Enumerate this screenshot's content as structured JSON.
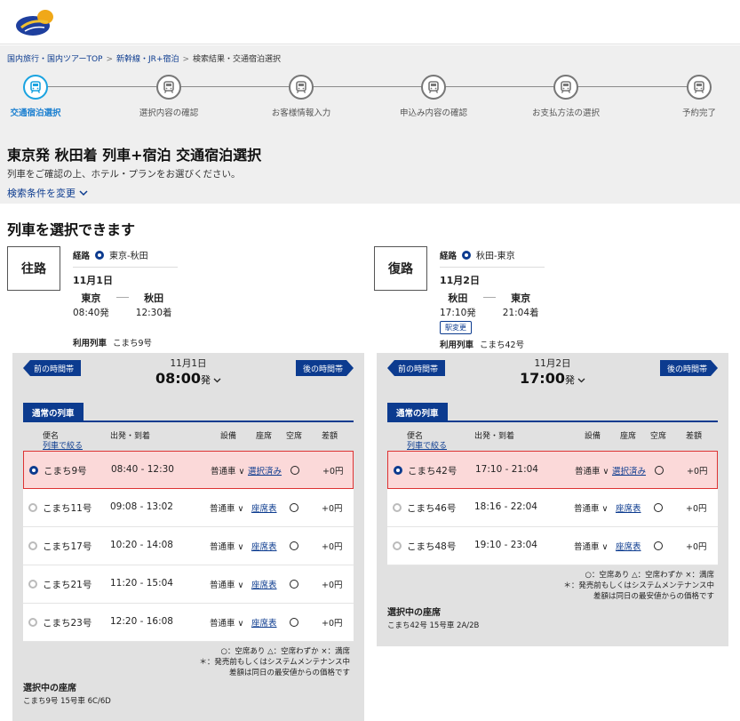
{
  "breadcrumb": [
    {
      "label": "国内旅行・国内ツアーTOP",
      "link": true
    },
    {
      "label": "新幹線・JR+宿泊",
      "link": true
    },
    {
      "label": "検索結果・交通宿泊選択",
      "link": false
    }
  ],
  "breadcrumb_sep": ">",
  "steps": [
    {
      "label": "交通宿泊選択",
      "active": true
    },
    {
      "label": "選択内容の確認",
      "active": false
    },
    {
      "label": "お客様情報入力",
      "active": false
    },
    {
      "label": "申込み内容の確認",
      "active": false
    },
    {
      "label": "お支払方法の選択",
      "active": false
    },
    {
      "label": "予約完了",
      "active": false
    }
  ],
  "page": {
    "title": "東京発 秋田着 列車+宿泊 交通宿泊選択",
    "subtitle": "列車をご確認の上、ホテル・プランをお選びください。",
    "change_condition": "検索条件を変更",
    "select_heading": "列車を選択できます"
  },
  "outbound": {
    "direction_label": "往路",
    "route_key": "経路",
    "route": "東京-秋田",
    "date": "11月1日",
    "from_station": "東京",
    "to_station": "秋田",
    "dep_time": "08:40発",
    "arr_time": "12:30着",
    "used_train_key": "利用列車",
    "used_train": "こまち9号",
    "panel": {
      "prev": "前の時間帯",
      "next": "後の時間帯",
      "date": "11月1日",
      "time": "08:00",
      "time_suffix": "発",
      "tab": "通常の列車",
      "cols": {
        "train": "便名",
        "filter": "列車で絞る",
        "time": "出発・到着",
        "equip": "設備",
        "seat": "座席",
        "avail": "空席",
        "diff": "差額"
      },
      "rows": [
        {
          "name": "こまち9号",
          "time": "08:40 - 12:30",
          "equip": "普通車",
          "seat": "選択済み",
          "price": "+0円",
          "selected": true
        },
        {
          "name": "こまち11号",
          "time": "09:08 - 13:02",
          "equip": "普通車",
          "seat": "座席表",
          "price": "+0円",
          "selected": false
        },
        {
          "name": "こまち17号",
          "time": "10:20 - 14:08",
          "equip": "普通車",
          "seat": "座席表",
          "price": "+0円",
          "selected": false
        },
        {
          "name": "こまち21号",
          "time": "11:20 - 15:04",
          "equip": "普通車",
          "seat": "座席表",
          "price": "+0円",
          "selected": false
        },
        {
          "name": "こまち23号",
          "time": "12:20 - 16:08",
          "equip": "普通車",
          "seat": "座席表",
          "price": "+0円",
          "selected": false
        }
      ],
      "legend": [
        "○：空席あり △：空席わずか ×：満席",
        "＊：発売前もしくはシステムメンテナンス中",
        "差額は同日の最安値からの価格です"
      ],
      "selected_seat_title": "選択中の座席",
      "selected_seat": "こまち9号 15号車 6C/6D"
    }
  },
  "return": {
    "direction_label": "復路",
    "route_key": "経路",
    "route": "秋田-東京",
    "date": "11月2日",
    "from_station": "秋田",
    "to_station": "東京",
    "dep_time": "17:10発",
    "arr_time": "21:04着",
    "change_btn": "駅変更",
    "used_train_key": "利用列車",
    "used_train": "こまち42号",
    "panel": {
      "prev": "前の時間帯",
      "next": "後の時間帯",
      "date": "11月2日",
      "time": "17:00",
      "time_suffix": "発",
      "tab": "通常の列車",
      "cols": {
        "train": "便名",
        "filter": "列車で絞る",
        "time": "出発・到着",
        "equip": "設備",
        "seat": "座席",
        "avail": "空席",
        "diff": "差額"
      },
      "rows": [
        {
          "name": "こまち42号",
          "time": "17:10 - 21:04",
          "equip": "普通車",
          "seat": "選択済み",
          "price": "+0円",
          "selected": true
        },
        {
          "name": "こまち46号",
          "time": "18:16 - 22:04",
          "equip": "普通車",
          "seat": "座席表",
          "price": "+0円",
          "selected": false
        },
        {
          "name": "こまち48号",
          "time": "19:10 - 23:04",
          "equip": "普通車",
          "seat": "座席表",
          "price": "+0円",
          "selected": false
        }
      ],
      "legend": [
        "○：空席あり △：空席わずか ×：満席",
        "＊：発売前もしくはシステムメンテナンス中",
        "差額は同日の最安値からの価格です"
      ],
      "selected_seat_title": "選択中の座席",
      "selected_seat": "こまち42号 15号車 2A/2B"
    }
  },
  "colors": {
    "brand": "#0c3b8f",
    "active_step": "#1aa3e0",
    "selected_row": "#fbd9d9"
  },
  "icons": {
    "step": "train-icon",
    "chevron": "chevron-down-icon",
    "logo": "site-logo"
  }
}
